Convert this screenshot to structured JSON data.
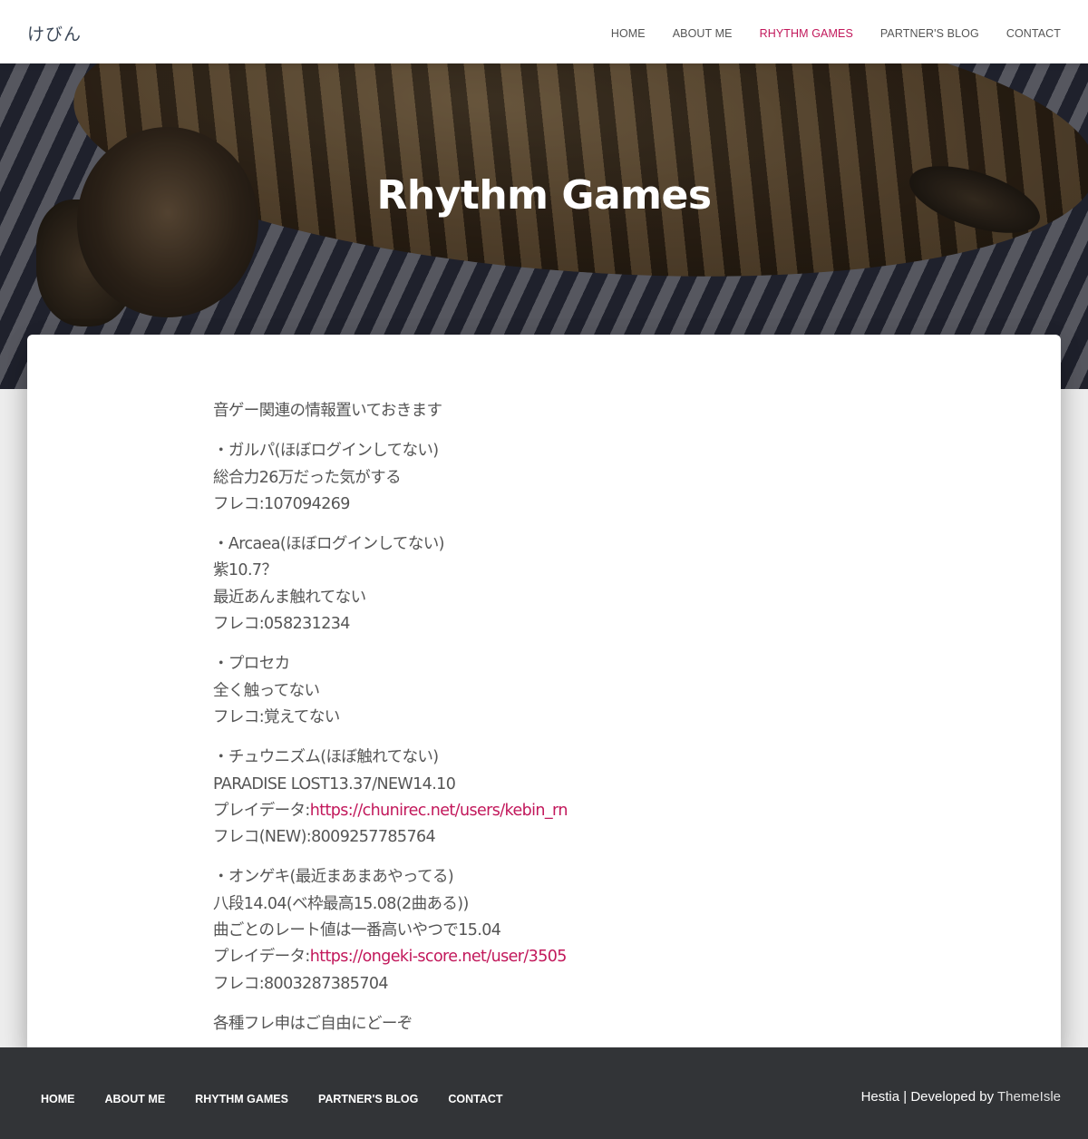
{
  "header": {
    "brand": "けびん",
    "nav": [
      {
        "label": "HOME",
        "active": false
      },
      {
        "label": "ABOUT ME",
        "active": false
      },
      {
        "label": "RHYTHM GAMES",
        "active": true
      },
      {
        "label": "PARTNER'S BLOG",
        "active": false
      },
      {
        "label": "CONTACT",
        "active": false
      }
    ]
  },
  "hero": {
    "title": "Rhythm Games"
  },
  "article": {
    "intro": "音ゲー関連の情報置いておきます",
    "garupa": {
      "line1": "・ガルパ(ほぼログインしてない)",
      "line2": "総合力26万だった気がする",
      "line3": "フレコ:107094269"
    },
    "arcaea": {
      "line1": "・Arcaea(ほぼログインしてない)",
      "line2": "紫10.7？",
      "line3": "最近あんま触れてない",
      "line4": "フレコ:058231234"
    },
    "proseka": {
      "line1": "・プロセカ",
      "line2": "全く触ってない",
      "line3": "フレコ:覚えてない"
    },
    "chunithm": {
      "line1": "・チュウニズム(ほぼ触れてない)",
      "line2": "PARADISE LOST13.37/NEW14.10",
      "line3_prefix": "プレイデータ:",
      "line3_link": "https://chunirec.net/users/kebin_rn",
      "line4": "フレコ(NEW):8009257785764"
    },
    "ongeki": {
      "line1": "・オンゲキ(最近まあまあやってる)",
      "line2": "八段14.04(ベ枠最高15.08(2曲ある))",
      "line3": "曲ごとのレート値は一番高いやつで15.04",
      "line4_prefix": "プレイデータ:",
      "line4_link": "https://ongeki-score.net/user/3505",
      "line5": "フレコ:8003287385704"
    },
    "outro": "各種フレ申はご自由にどーぞ"
  },
  "footer": {
    "nav": [
      "HOME",
      "ABOUT ME",
      "RHYTHM GAMES",
      "PARTNER'S BLOG",
      "CONTACT"
    ],
    "credit_prefix": "Hestia | Developed by ",
    "credit_link": "ThemeIsle"
  },
  "colors": {
    "accent": "#c2185b",
    "footer_bg": "#323437",
    "text": "#555555"
  }
}
